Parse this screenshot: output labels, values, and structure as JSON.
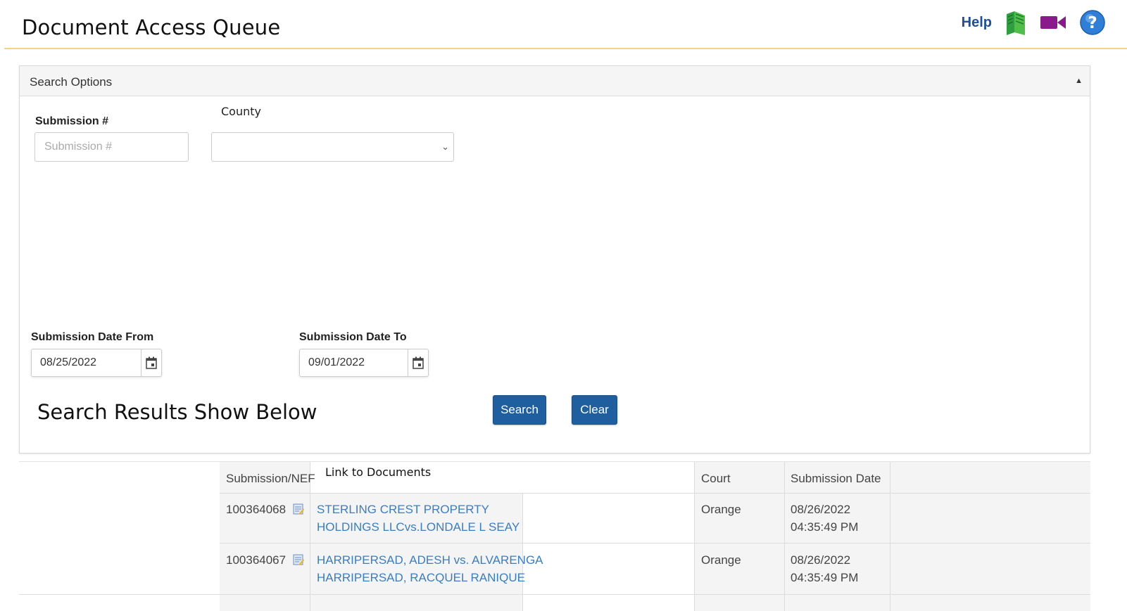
{
  "header": {
    "title": "Document Access Queue",
    "help_label": "Help",
    "icons": [
      "help-book-icon",
      "video-icon",
      "question-icon"
    ]
  },
  "search_panel": {
    "heading": "Search Options",
    "submission_label": "Submission #",
    "submission_placeholder": "Submission #",
    "submission_value": "",
    "county_label": "County",
    "county_value": "",
    "date_from_label": "Submission Date From",
    "date_from_value": "08/25/2022",
    "date_to_label": "Submission Date To",
    "date_to_value": "09/01/2022",
    "results_heading": "Search Results Show Below",
    "search_button": "Search",
    "clear_button": "Clear"
  },
  "results": {
    "columns": {
      "submission": "Submission/NEF",
      "link": "Link to Documents",
      "court": "Court",
      "date": "Submission Date"
    },
    "rows": [
      {
        "submission": "100364068",
        "link_line1": "STERLING CREST PROPERTY",
        "link_line2": "HOLDINGS LLCvs.LONDALE L SEAY",
        "court": "Orange",
        "date_line1": "08/26/2022",
        "date_line2": "04:35:49 PM"
      },
      {
        "submission": "100364067",
        "link_line1": "HARRIPERSAD, ADESH vs. ALVARENGA",
        "link_line2": "HARRIPERSAD, RACQUEL RANIQUE",
        "court": "Orange",
        "date_line1": "08/26/2022",
        "date_line2": "04:35:49 PM"
      }
    ]
  },
  "colors": {
    "accent_blue": "#1f5fa0",
    "link_blue": "#3a7dc4",
    "header_rule": "#f2d48a",
    "help_green": "#2e9e3e",
    "video_purple": "#8a1a8c",
    "question_blue": "#2f7fd8"
  }
}
